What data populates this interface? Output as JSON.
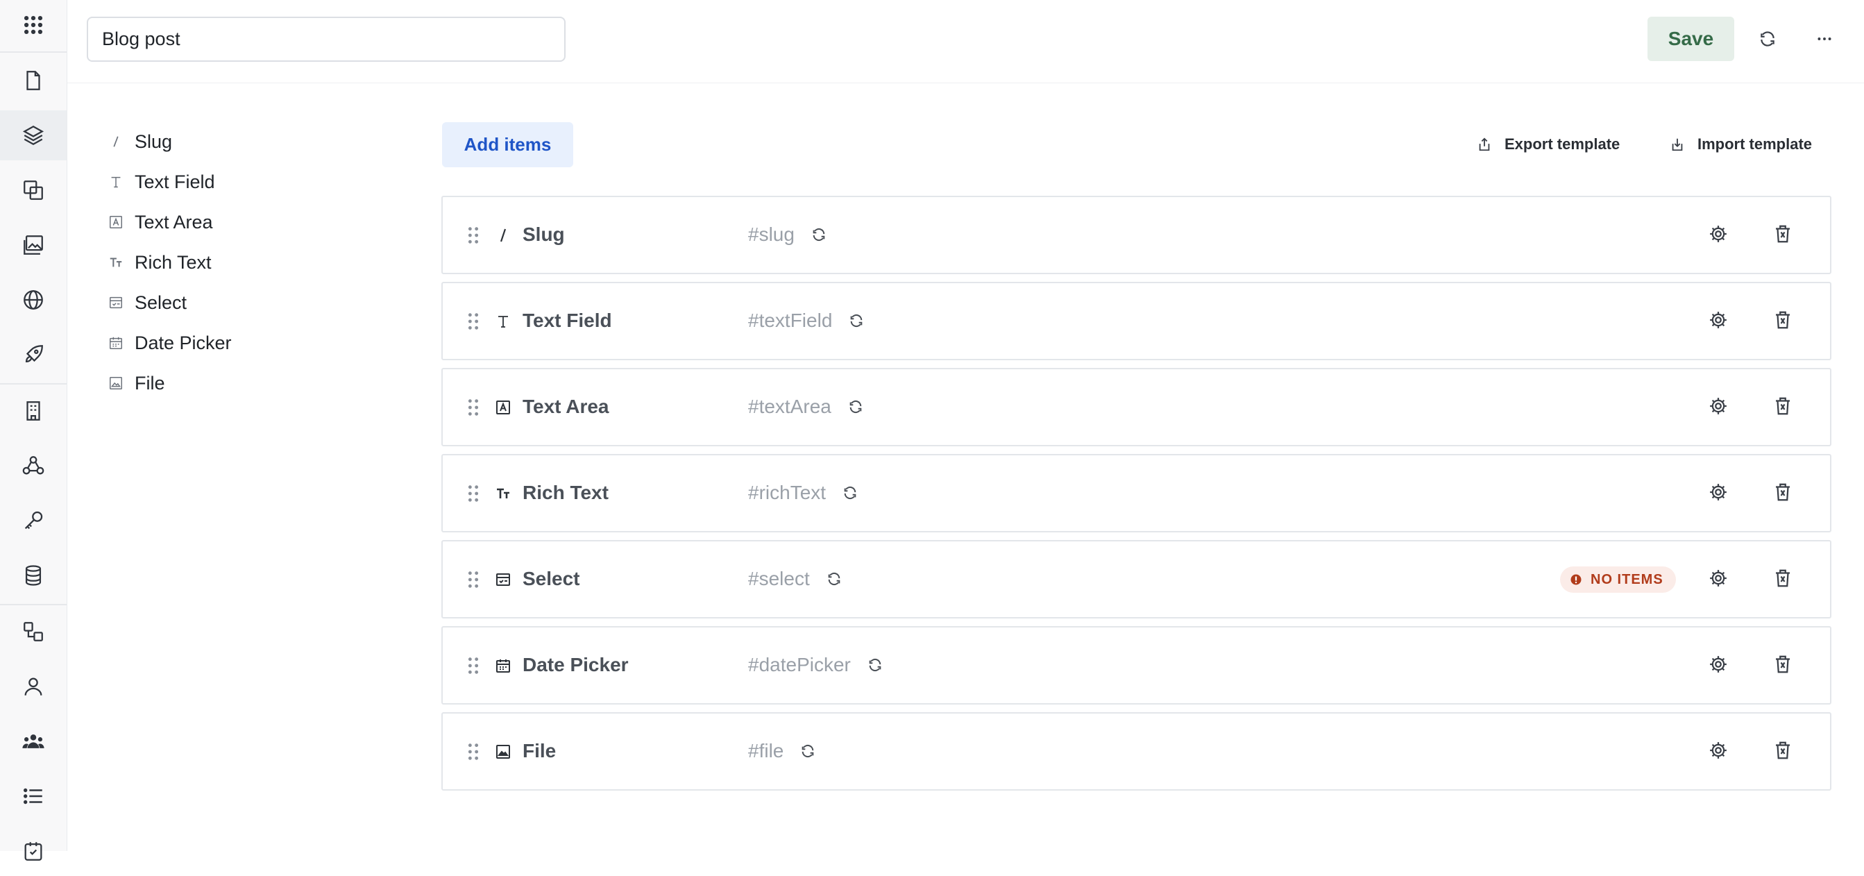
{
  "rail": {
    "items": [
      {
        "icon": "apps-grid-icon"
      },
      {
        "icon": "document-icon"
      },
      {
        "icon": "layers-icon"
      },
      {
        "icon": "components-icon"
      },
      {
        "icon": "media-gallery-icon"
      },
      {
        "icon": "globe-icon"
      },
      {
        "icon": "rocket-icon"
      },
      {
        "icon": "building-icon"
      },
      {
        "icon": "webhook-icon"
      },
      {
        "icon": "key-icon"
      },
      {
        "icon": "database-icon"
      },
      {
        "icon": "workflow-icon"
      },
      {
        "icon": "user-icon"
      },
      {
        "icon": "team-icon"
      },
      {
        "icon": "list-icon"
      },
      {
        "icon": "badge-icon"
      }
    ],
    "active_index": 2
  },
  "header": {
    "title_value": "Blog post",
    "save_label": "Save",
    "save_color": "#356b48",
    "refresh_icon": "refresh-icon",
    "more_icon": "more-horizontal-icon"
  },
  "field_types": [
    {
      "icon": "slash-icon",
      "label": "Slug"
    },
    {
      "icon": "text-t-icon",
      "label": "Text Field"
    },
    {
      "icon": "text-area-icon",
      "label": "Text Area"
    },
    {
      "icon": "rich-text-icon",
      "label": "Rich Text"
    },
    {
      "icon": "select-icon",
      "label": "Select"
    },
    {
      "icon": "calendar-icon",
      "label": "Date Picker"
    },
    {
      "icon": "image-icon",
      "label": "File"
    }
  ],
  "toolbar": {
    "add_items_label": "Add items",
    "export_label": "Export template",
    "import_label": "Import template",
    "accent_color": "#1f55c7"
  },
  "fields": [
    {
      "icon": "slash-icon",
      "name": "Slug",
      "api_id": "#slug",
      "badge": null
    },
    {
      "icon": "text-t-icon",
      "name": "Text Field",
      "api_id": "#textField",
      "badge": null
    },
    {
      "icon": "text-area-icon",
      "name": "Text Area",
      "api_id": "#textArea",
      "badge": null
    },
    {
      "icon": "rich-text-icon",
      "name": "Rich Text",
      "api_id": "#richText",
      "badge": null
    },
    {
      "icon": "select-icon",
      "name": "Select",
      "api_id": "#select",
      "badge": "NO ITEMS"
    },
    {
      "icon": "calendar-icon",
      "name": "Date Picker",
      "api_id": "#datePicker",
      "badge": null
    },
    {
      "icon": "image-icon",
      "name": "File",
      "api_id": "#file",
      "badge": null
    }
  ],
  "colors": {
    "badge_text": "#b13c1b",
    "badge_bg": "#fbece8"
  }
}
